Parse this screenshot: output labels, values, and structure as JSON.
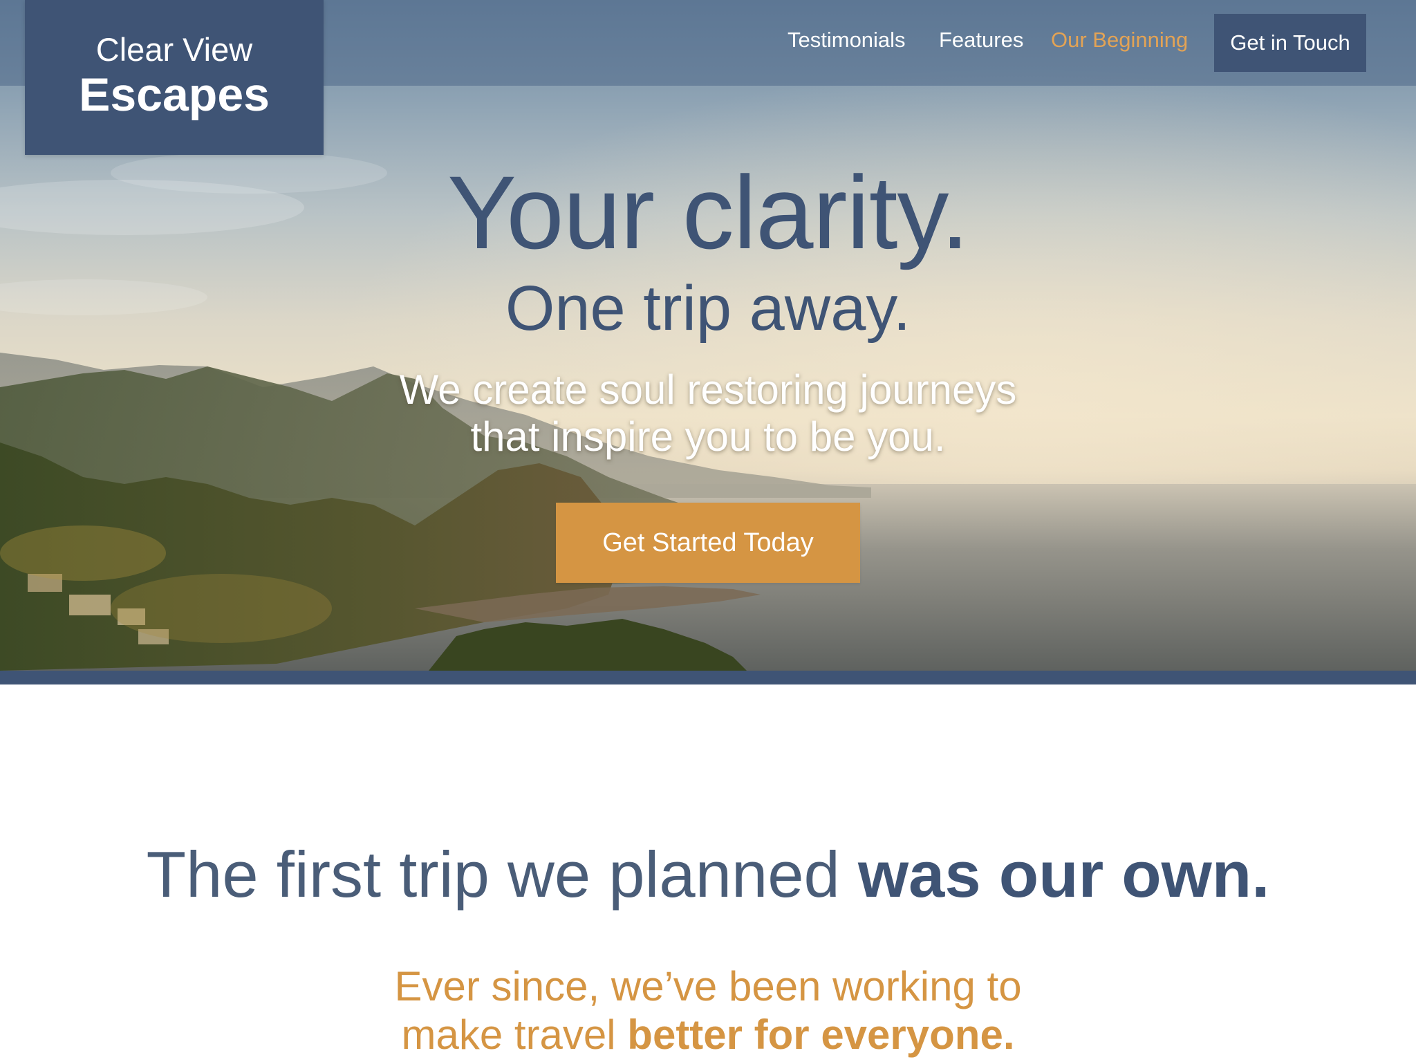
{
  "brand": {
    "line1": "Clear View",
    "line2": "Escapes",
    "color": "#3f5475"
  },
  "nav": {
    "items": [
      {
        "label": "Testimonials",
        "active": false
      },
      {
        "label": "Features",
        "active": false
      },
      {
        "label": "Our Beginning",
        "active": true
      }
    ],
    "cta_label": "Get in Touch"
  },
  "hero": {
    "title": "Your clarity.",
    "subtitle": "One trip away.",
    "description_line1": "We create soul restoring journeys",
    "description_line2": "that inspire you to be you.",
    "cta_label": "Get Started Today",
    "image": "coastal-mountains-sea-photo"
  },
  "story": {
    "heading_light": "The first trip we planned ",
    "heading_bold": "was our own.",
    "sub_line1": "Ever since, we’ve been working to",
    "sub_line2_light": "make travel ",
    "sub_line2_bold": "better for everyone."
  },
  "colors": {
    "primary": "#3f5475",
    "accent": "#d59543",
    "nav_active": "#e3a355"
  }
}
